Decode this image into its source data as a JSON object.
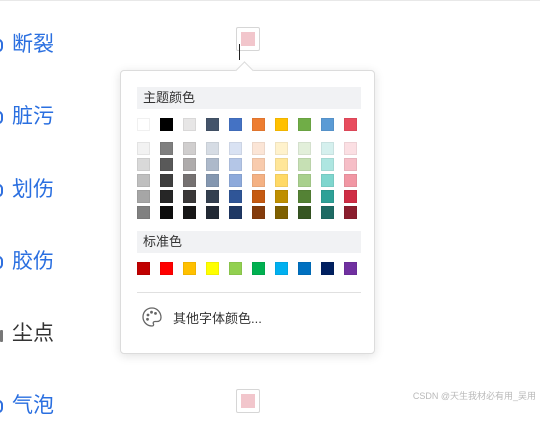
{
  "defects": [
    {
      "label": "断裂",
      "style": "blue"
    },
    {
      "label": "脏污",
      "style": "blue"
    },
    {
      "label": "划伤",
      "style": "blue"
    },
    {
      "label": "胶伤",
      "style": "blue"
    },
    {
      "label": "尘点",
      "style": "plain"
    },
    {
      "label": "气泡",
      "style": "blue"
    }
  ],
  "color_trigger": {
    "current_color": "#f2c6cc"
  },
  "popup": {
    "theme_title": "主题颜色",
    "theme_base": [
      "#ffffff",
      "#000000",
      "#e7e6e6",
      "#44546a",
      "#4472c4",
      "#ed7d31",
      "#ffc000",
      "#70ad47",
      "#5b9bd5",
      "#e84c5e"
    ],
    "theme_shades": [
      [
        "#f2f2f2",
        "#7f7f7f",
        "#d0cece",
        "#d6dce4",
        "#d9e2f3",
        "#fbe5d6",
        "#fff2cc",
        "#e2efda",
        "#d5f0ee",
        "#fbdfe3"
      ],
      [
        "#d9d9d9",
        "#595959",
        "#aeabab",
        "#adb9ca",
        "#b4c6e7",
        "#f8cbad",
        "#ffe699",
        "#c6e0b4",
        "#aee6e1",
        "#f6bec7"
      ],
      [
        "#bfbfbf",
        "#3f3f3f",
        "#757171",
        "#8497b0",
        "#8eaadb",
        "#f4b183",
        "#ffd966",
        "#a9d08e",
        "#7fd6ce",
        "#f197a4"
      ],
      [
        "#a6a6a6",
        "#262626",
        "#3a3838",
        "#333f4f",
        "#2f5597",
        "#c55a11",
        "#bf8f00",
        "#548235",
        "#2ea197",
        "#cf2d45"
      ],
      [
        "#808080",
        "#0d0d0d",
        "#171616",
        "#222a35",
        "#1f3864",
        "#843c0c",
        "#7f6000",
        "#375623",
        "#1e6b64",
        "#8b1e2e"
      ]
    ],
    "standard_title": "标准色",
    "standard_colors": [
      "#c00000",
      "#ff0000",
      "#ffc000",
      "#ffff00",
      "#92d050",
      "#00b050",
      "#00b0f0",
      "#0070c0",
      "#002060",
      "#7030a0"
    ],
    "more_colors_label": "其他字体颜色..."
  },
  "watermark": "CSDN @天生我材必有用_吴用"
}
